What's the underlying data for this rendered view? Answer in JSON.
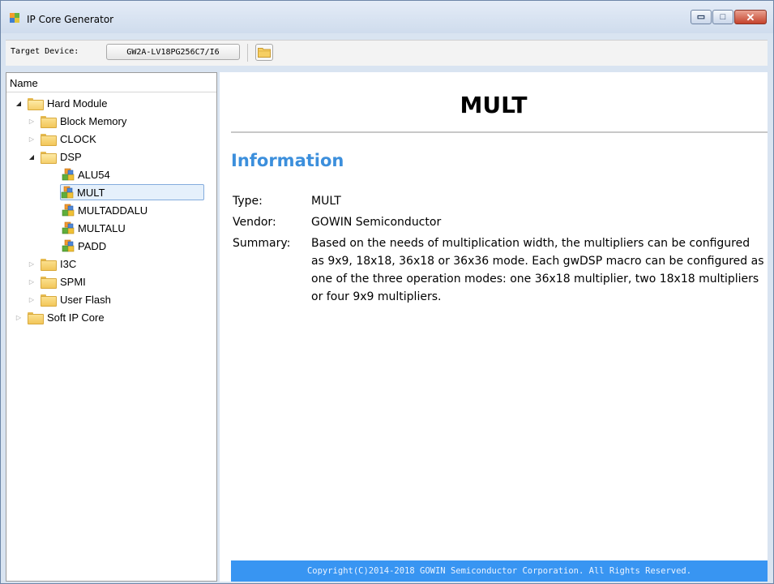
{
  "window": {
    "title": "IP Core Generator",
    "controls": {
      "minimize": "▭",
      "maximize": "□",
      "close": "✕"
    }
  },
  "toolbar": {
    "target_device_label": "Target Device:",
    "target_device_value": "GW2A-LV18PG256C7/I6",
    "folder_icon": "folder-open-icon"
  },
  "tree": {
    "header": "Name",
    "items": [
      {
        "label": "Hard Module",
        "level": 0,
        "state": "expanded",
        "icon": "folder-open"
      },
      {
        "label": "Block Memory",
        "level": 1,
        "state": "collapsed",
        "icon": "folder"
      },
      {
        "label": "CLOCK",
        "level": 1,
        "state": "collapsed",
        "icon": "folder"
      },
      {
        "label": "DSP",
        "level": 1,
        "state": "expanded",
        "icon": "folder-open"
      },
      {
        "label": "ALU54",
        "level": 2,
        "state": "leaf",
        "icon": "ip-cube"
      },
      {
        "label": "MULT",
        "level": 2,
        "state": "leaf",
        "icon": "ip-cube",
        "selected": true
      },
      {
        "label": "MULTADDALU",
        "level": 2,
        "state": "leaf",
        "icon": "ip-cube"
      },
      {
        "label": "MULTALU",
        "level": 2,
        "state": "leaf",
        "icon": "ip-cube"
      },
      {
        "label": "PADD",
        "level": 2,
        "state": "leaf",
        "icon": "ip-cube"
      },
      {
        "label": "I3C",
        "level": 1,
        "state": "collapsed",
        "icon": "folder"
      },
      {
        "label": "SPMI",
        "level": 1,
        "state": "collapsed",
        "icon": "folder"
      },
      {
        "label": "User Flash",
        "level": 1,
        "state": "collapsed",
        "icon": "folder"
      },
      {
        "label": "Soft IP Core",
        "level": 0,
        "state": "collapsed",
        "icon": "folder"
      }
    ]
  },
  "content": {
    "title": "MULT",
    "section": "Information",
    "type_label": "Type:",
    "type_value": "MULT",
    "vendor_label": "Vendor:",
    "vendor_value": "GOWIN Semiconductor",
    "summary_label": "Summary:",
    "summary_value": "Based on the needs of multiplication width, the multipliers can be configured as 9x9, 18x18, 36x18 or 36x36 mode. Each gwDSP macro can be configured as one of the three operation modes: one 36x18 multiplier, two 18x18 multipliers or four 9x9 multipliers.",
    "footer": "Copyright(C)2014-2018 GOWIN Semiconductor Corporation. All Rights Reserved."
  },
  "colors": {
    "accent": "#3c8fdc",
    "footer_bg": "#3895f2",
    "selection_bg": "#e5f0fb",
    "selection_border": "#84acdd"
  }
}
